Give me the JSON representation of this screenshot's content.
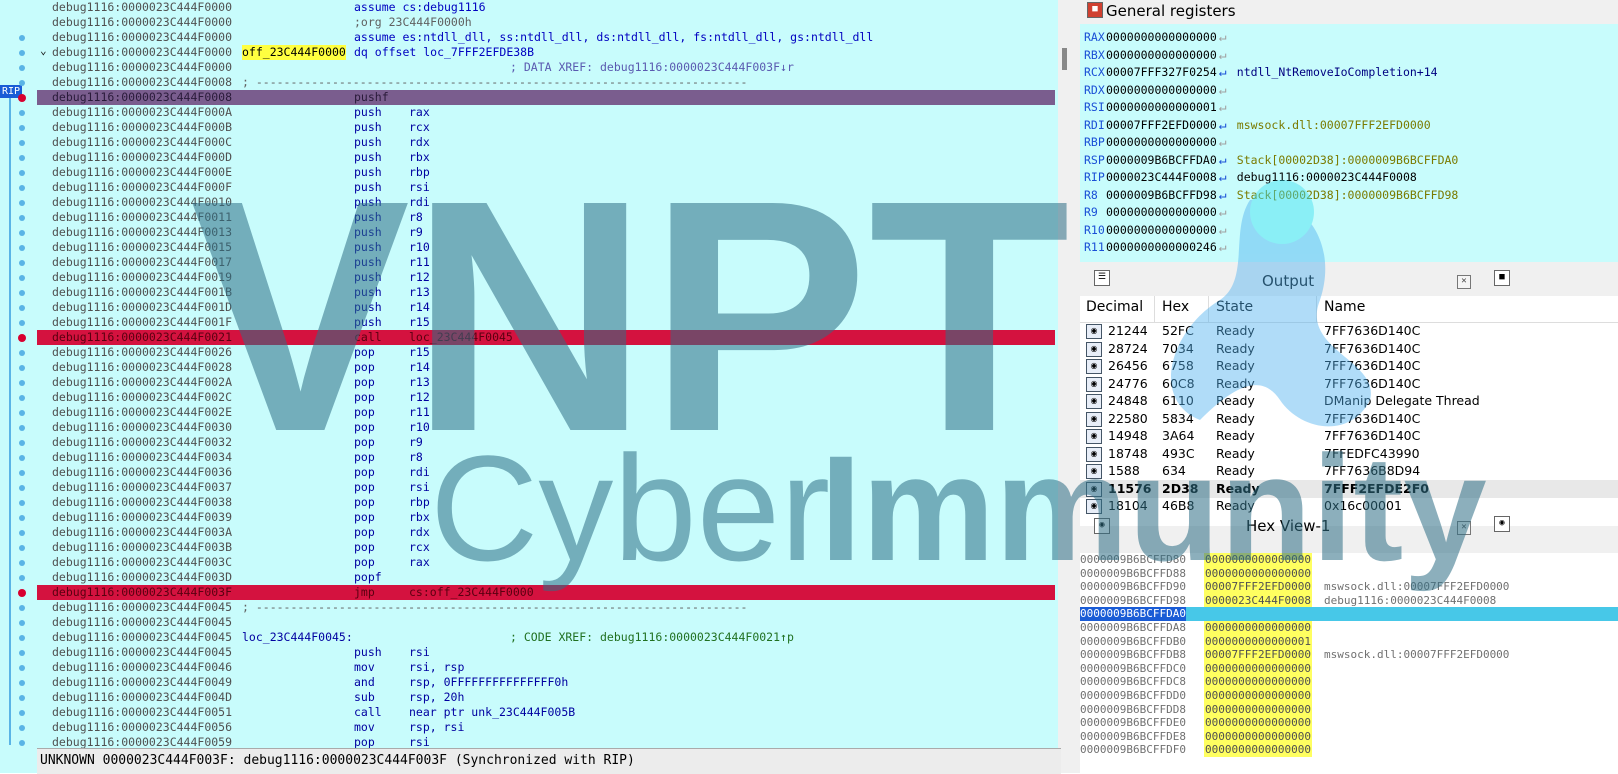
{
  "disasm": {
    "rip_tag": "RIP",
    "lines": [
      {
        "addr": "debug1116:0000023C444F0000",
        "label": "",
        "mn": "",
        "op": "",
        "dir": "assume cs:debug1116",
        "cmt": "",
        "hl": ""
      },
      {
        "addr": "debug1116:0000023C444F0000",
        "label": "",
        "mn": "",
        "op": "",
        "dir": "",
        "cmt": ";org 23C444F0000h",
        "hl": ""
      },
      {
        "addr": "debug1116:0000023C444F0000",
        "label": "",
        "mn": "",
        "op": "",
        "dir": "assume es:ntdll_dll, ss:ntdll_dll, ds:ntdll_dll, fs:ntdll_dll, gs:ntdll_dll",
        "cmt": "",
        "hl": ""
      },
      {
        "addr": "debug1116:0000023C444F0000",
        "label": "off_23C444F0000",
        "mn": "",
        "op": "",
        "dir": "dq offset loc_7FFF2EFDE38B",
        "cmt": "",
        "hl": ""
      },
      {
        "addr": "debug1116:0000023C444F0000",
        "label": "",
        "mn": "",
        "op": "",
        "dir": "",
        "cmt": "; DATA XREF: debug1116:0000023C444F003F↓r",
        "hl": ""
      },
      {
        "addr": "debug1116:0000023C444F0008",
        "label": "",
        "mn": "",
        "op": "",
        "dir": "",
        "cmt": "",
        "sep": "; -----------------------------------------------------------------------",
        "hl": ""
      },
      {
        "addr": "debug1116:0000023C444F0008",
        "label": "",
        "mn": "pushf",
        "op": "",
        "dir": "",
        "cmt": "",
        "hl": "purple"
      },
      {
        "addr": "debug1116:0000023C444F000A",
        "label": "",
        "mn": "push",
        "op": "rax",
        "dir": "",
        "cmt": "",
        "hl": ""
      },
      {
        "addr": "debug1116:0000023C444F000B",
        "label": "",
        "mn": "push",
        "op": "rcx",
        "dir": "",
        "cmt": "",
        "hl": ""
      },
      {
        "addr": "debug1116:0000023C444F000C",
        "label": "",
        "mn": "push",
        "op": "rdx",
        "dir": "",
        "cmt": "",
        "hl": ""
      },
      {
        "addr": "debug1116:0000023C444F000D",
        "label": "",
        "mn": "push",
        "op": "rbx",
        "dir": "",
        "cmt": "",
        "hl": ""
      },
      {
        "addr": "debug1116:0000023C444F000E",
        "label": "",
        "mn": "push",
        "op": "rbp",
        "dir": "",
        "cmt": "",
        "hl": ""
      },
      {
        "addr": "debug1116:0000023C444F000F",
        "label": "",
        "mn": "push",
        "op": "rsi",
        "dir": "",
        "cmt": "",
        "hl": ""
      },
      {
        "addr": "debug1116:0000023C444F0010",
        "label": "",
        "mn": "push",
        "op": "rdi",
        "dir": "",
        "cmt": "",
        "hl": ""
      },
      {
        "addr": "debug1116:0000023C444F0011",
        "label": "",
        "mn": "push",
        "op": "r8",
        "dir": "",
        "cmt": "",
        "hl": ""
      },
      {
        "addr": "debug1116:0000023C444F0013",
        "label": "",
        "mn": "push",
        "op": "r9",
        "dir": "",
        "cmt": "",
        "hl": ""
      },
      {
        "addr": "debug1116:0000023C444F0015",
        "label": "",
        "mn": "push",
        "op": "r10",
        "dir": "",
        "cmt": "",
        "hl": ""
      },
      {
        "addr": "debug1116:0000023C444F0017",
        "label": "",
        "mn": "push",
        "op": "r11",
        "dir": "",
        "cmt": "",
        "hl": ""
      },
      {
        "addr": "debug1116:0000023C444F0019",
        "label": "",
        "mn": "push",
        "op": "r12",
        "dir": "",
        "cmt": "",
        "hl": ""
      },
      {
        "addr": "debug1116:0000023C444F001B",
        "label": "",
        "mn": "push",
        "op": "r13",
        "dir": "",
        "cmt": "",
        "hl": ""
      },
      {
        "addr": "debug1116:0000023C444F001D",
        "label": "",
        "mn": "push",
        "op": "r14",
        "dir": "",
        "cmt": "",
        "hl": ""
      },
      {
        "addr": "debug1116:0000023C444F001F",
        "label": "",
        "mn": "push",
        "op": "r15",
        "dir": "",
        "cmt": "",
        "hl": ""
      },
      {
        "addr": "debug1116:0000023C444F0021",
        "label": "",
        "mn": "call",
        "op": "loc_23C444F0045",
        "dir": "",
        "cmt": "",
        "hl": "red"
      },
      {
        "addr": "debug1116:0000023C444F0026",
        "label": "",
        "mn": "pop",
        "op": "r15",
        "dir": "",
        "cmt": "",
        "hl": ""
      },
      {
        "addr": "debug1116:0000023C444F0028",
        "label": "",
        "mn": "pop",
        "op": "r14",
        "dir": "",
        "cmt": "",
        "hl": ""
      },
      {
        "addr": "debug1116:0000023C444F002A",
        "label": "",
        "mn": "pop",
        "op": "r13",
        "dir": "",
        "cmt": "",
        "hl": ""
      },
      {
        "addr": "debug1116:0000023C444F002C",
        "label": "",
        "mn": "pop",
        "op": "r12",
        "dir": "",
        "cmt": "",
        "hl": ""
      },
      {
        "addr": "debug1116:0000023C444F002E",
        "label": "",
        "mn": "pop",
        "op": "r11",
        "dir": "",
        "cmt": "",
        "hl": ""
      },
      {
        "addr": "debug1116:0000023C444F0030",
        "label": "",
        "mn": "pop",
        "op": "r10",
        "dir": "",
        "cmt": "",
        "hl": ""
      },
      {
        "addr": "debug1116:0000023C444F0032",
        "label": "",
        "mn": "pop",
        "op": "r9",
        "dir": "",
        "cmt": "",
        "hl": ""
      },
      {
        "addr": "debug1116:0000023C444F0034",
        "label": "",
        "mn": "pop",
        "op": "r8",
        "dir": "",
        "cmt": "",
        "hl": ""
      },
      {
        "addr": "debug1116:0000023C444F0036",
        "label": "",
        "mn": "pop",
        "op": "rdi",
        "dir": "",
        "cmt": "",
        "hl": ""
      },
      {
        "addr": "debug1116:0000023C444F0037",
        "label": "",
        "mn": "pop",
        "op": "rsi",
        "dir": "",
        "cmt": "",
        "hl": ""
      },
      {
        "addr": "debug1116:0000023C444F0038",
        "label": "",
        "mn": "pop",
        "op": "rbp",
        "dir": "",
        "cmt": "",
        "hl": ""
      },
      {
        "addr": "debug1116:0000023C444F0039",
        "label": "",
        "mn": "pop",
        "op": "rbx",
        "dir": "",
        "cmt": "",
        "hl": ""
      },
      {
        "addr": "debug1116:0000023C444F003A",
        "label": "",
        "mn": "pop",
        "op": "rdx",
        "dir": "",
        "cmt": "",
        "hl": ""
      },
      {
        "addr": "debug1116:0000023C444F003B",
        "label": "",
        "mn": "pop",
        "op": "rcx",
        "dir": "",
        "cmt": "",
        "hl": ""
      },
      {
        "addr": "debug1116:0000023C444F003C",
        "label": "",
        "mn": "pop",
        "op": "rax",
        "dir": "",
        "cmt": "",
        "hl": ""
      },
      {
        "addr": "debug1116:0000023C444F003D",
        "label": "",
        "mn": "popf",
        "op": "",
        "dir": "",
        "cmt": "",
        "hl": ""
      },
      {
        "addr": "debug1116:0000023C444F003F",
        "label": "",
        "mn": "jmp",
        "op": "cs:off_23C444F0000",
        "dir": "",
        "cmt": "",
        "hl": "red"
      },
      {
        "addr": "debug1116:0000023C444F0045",
        "label": "",
        "mn": "",
        "op": "",
        "dir": "",
        "cmt": "",
        "sep": "; -----------------------------------------------------------------------",
        "hl": ""
      },
      {
        "addr": "debug1116:0000023C444F0045",
        "label": "",
        "mn": "",
        "op": "",
        "dir": "",
        "cmt": "",
        "hl": ""
      },
      {
        "addr": "debug1116:0000023C444F0045",
        "label": "loc_23C444F0045:",
        "mn": "",
        "op": "",
        "dir": "",
        "cmt": "",
        "xref": "; CODE XREF: debug1116:0000023C444F0021↑p",
        "hl": ""
      },
      {
        "addr": "debug1116:0000023C444F0045",
        "label": "",
        "mn": "push",
        "op": "rsi",
        "dir": "",
        "cmt": "",
        "hl": ""
      },
      {
        "addr": "debug1116:0000023C444F0046",
        "label": "",
        "mn": "mov",
        "op": "rsi, rsp",
        "dir": "",
        "cmt": "",
        "hl": ""
      },
      {
        "addr": "debug1116:0000023C444F0049",
        "label": "",
        "mn": "and",
        "op": "rsp, 0FFFFFFFFFFFFFFF0h",
        "dir": "",
        "cmt": "",
        "hl": ""
      },
      {
        "addr": "debug1116:0000023C444F004D",
        "label": "",
        "mn": "sub",
        "op": "rsp, 20h",
        "dir": "",
        "cmt": "",
        "hl": ""
      },
      {
        "addr": "debug1116:0000023C444F0051",
        "label": "",
        "mn": "call",
        "op": "near ptr unk_23C444F005B",
        "dir": "",
        "cmt": "",
        "hl": ""
      },
      {
        "addr": "debug1116:0000023C444F0056",
        "label": "",
        "mn": "mov",
        "op": "rsp, rsi",
        "dir": "",
        "cmt": "",
        "hl": ""
      },
      {
        "addr": "debug1116:0000023C444F0059",
        "label": "",
        "mn": "pop",
        "op": "rsi",
        "dir": "",
        "cmt": "",
        "hl": ""
      }
    ],
    "status": "UNKNOWN 0000023C444F003F: debug1116:0000023C444F003F (Synchronized with RIP)"
  },
  "registers": {
    "title": "General registers",
    "items": [
      {
        "name": "RAX",
        "value": "0000000000000000",
        "label": "",
        "kind": "",
        "arrow": "gray"
      },
      {
        "name": "RBX",
        "value": "0000000000000000",
        "label": "",
        "kind": "",
        "arrow": "gray"
      },
      {
        "name": "RCX",
        "value": "00007FFF327F0254",
        "label": "ntdll_NtRemoveIoCompletion+14",
        "kind": "ntdll",
        "arrow": "blue"
      },
      {
        "name": "RDX",
        "value": "0000000000000000",
        "label": "",
        "kind": "",
        "arrow": "gray"
      },
      {
        "name": "RSI",
        "value": "0000000000000001",
        "label": "",
        "kind": "",
        "arrow": "gray"
      },
      {
        "name": "RDI",
        "value": "00007FFF2EFD0000",
        "label": "mswsock.dll:00007FFF2EFD0000",
        "kind": "dll",
        "arrow": "blue"
      },
      {
        "name": "RBP",
        "value": "0000000000000000",
        "label": "",
        "kind": "",
        "arrow": "gray"
      },
      {
        "name": "RSP",
        "value": "0000009B6BCFFDA0",
        "label": "Stack[00002D38]:0000009B6BCFFDA0",
        "kind": "stk",
        "arrow": "blue"
      },
      {
        "name": "RIP",
        "value": "0000023C444F0008",
        "label": "debug1116:0000023C444F0008",
        "kind": "dbg",
        "arrow": "blue"
      },
      {
        "name": "R8",
        "value": "0000009B6BCFFD98",
        "label": "Stack[00002D38]:0000009B6BCFFD98",
        "kind": "stk",
        "arrow": "blue"
      },
      {
        "name": "R9",
        "value": "0000000000000000",
        "label": "",
        "kind": "",
        "arrow": "gray"
      },
      {
        "name": "R10",
        "value": "0000000000000000",
        "label": "",
        "kind": "",
        "arrow": "gray"
      },
      {
        "name": "R11",
        "value": "0000000000000246",
        "label": "",
        "kind": "",
        "arrow": "gray"
      }
    ]
  },
  "output": {
    "title": "Output",
    "columns": [
      "Decimal",
      "Hex",
      "State",
      "Name"
    ],
    "rows": [
      {
        "dec": "21244",
        "hex": "52FC",
        "state": "Ready",
        "name": "7FF7636D140C",
        "sel": false
      },
      {
        "dec": "28724",
        "hex": "7034",
        "state": "Ready",
        "name": "7FF7636D140C",
        "sel": false
      },
      {
        "dec": "26456",
        "hex": "6758",
        "state": "Ready",
        "name": "7FF7636D140C",
        "sel": false
      },
      {
        "dec": "24776",
        "hex": "60C8",
        "state": "Ready",
        "name": "7FF7636D140C",
        "sel": false
      },
      {
        "dec": "24848",
        "hex": "6110",
        "state": "Ready",
        "name": "DManip Delegate Thread",
        "sel": false
      },
      {
        "dec": "22580",
        "hex": "5834",
        "state": "Ready",
        "name": "7FF7636D140C",
        "sel": false
      },
      {
        "dec": "14948",
        "hex": "3A64",
        "state": "Ready",
        "name": "7FF7636D140C",
        "sel": false
      },
      {
        "dec": "18748",
        "hex": "493C",
        "state": "Ready",
        "name": "7FFEDFC43990",
        "sel": false
      },
      {
        "dec": "1588",
        "hex": "634",
        "state": "Ready",
        "name": "7FF7636B8D94",
        "sel": false
      },
      {
        "dec": "11576",
        "hex": "2D38",
        "state": "Ready",
        "name": "7FFF2EFDE2F0",
        "sel": true
      },
      {
        "dec": "18104",
        "hex": "46B8",
        "state": "Ready",
        "name": "0x16c00001",
        "sel": false
      }
    ]
  },
  "hexview": {
    "title": "Hex View-1",
    "rows": [
      {
        "addr": "0000009B6BCFFD80",
        "val": "0000000000000000",
        "cmt": "",
        "sel": false
      },
      {
        "addr": "0000009B6BCFFD88",
        "val": "0000000000000000",
        "cmt": "",
        "sel": false
      },
      {
        "addr": "0000009B6BCFFD90",
        "val": "00007FFF2EFD0000",
        "cmt": "mswsock.dll:00007FFF2EFD0000",
        "sel": false
      },
      {
        "addr": "0000009B6BCFFD98",
        "val": "0000023C444F0008",
        "cmt": "debug1116:0000023C444F0008",
        "sel": false
      },
      {
        "addr": "0000009B6BCFFDA0",
        "val": "0000000000000000",
        "cmt": "",
        "sel": true
      },
      {
        "addr": "0000009B6BCFFDA8",
        "val": "0000000000000000",
        "cmt": "",
        "sel": false
      },
      {
        "addr": "0000009B6BCFFDB0",
        "val": "0000000000000001",
        "cmt": "",
        "sel": false
      },
      {
        "addr": "0000009B6BCFFDB8",
        "val": "00007FFF2EFD0000",
        "cmt": "mswsock.dll:00007FFF2EFD0000",
        "sel": false
      },
      {
        "addr": "0000009B6BCFFDC0",
        "val": "0000000000000000",
        "cmt": "",
        "sel": false
      },
      {
        "addr": "0000009B6BCFFDC8",
        "val": "0000000000000000",
        "cmt": "",
        "sel": false
      },
      {
        "addr": "0000009B6BCFFDD0",
        "val": "0000000000000000",
        "cmt": "",
        "sel": false
      },
      {
        "addr": "0000009B6BCFFDD8",
        "val": "0000000000000000",
        "cmt": "",
        "sel": false
      },
      {
        "addr": "0000009B6BCFFDE0",
        "val": "0000000000000000",
        "cmt": "",
        "sel": false
      },
      {
        "addr": "0000009B6BCFFDE8",
        "val": "0000000000000000",
        "cmt": "",
        "sel": false
      },
      {
        "addr": "0000009B6BCFFDF0",
        "val": "0000000000000000",
        "cmt": "",
        "sel": false
      }
    ]
  },
  "watermark": {
    "word1": "VNPT",
    "word2a": "Cyber",
    "word2b": "Immunity",
    "color": "#2f6f86"
  }
}
